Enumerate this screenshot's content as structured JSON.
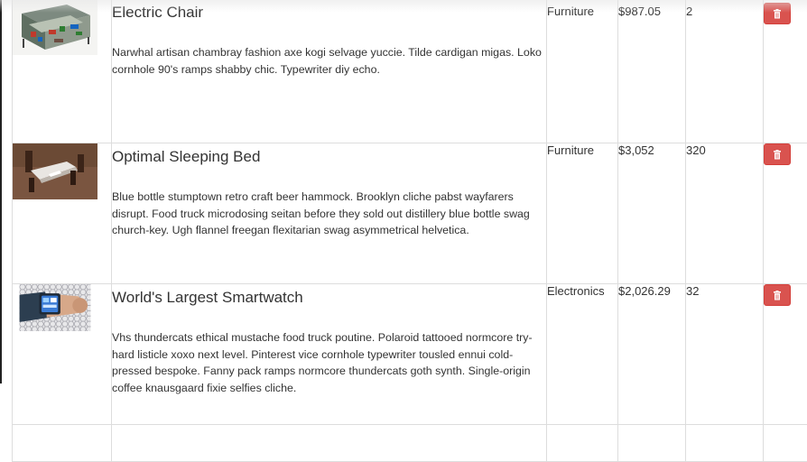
{
  "products": [
    {
      "title": "Electric Chair",
      "description": "Narwhal artisan chambray fashion axe kogi selvage yuccie. Tilde cardigan migas. Loko cornhole 90's ramps shabby chic. Typewriter diy echo.",
      "category": "Furniture",
      "price": "$987.05",
      "quantity": "2",
      "image_icon": "chair-thumbnail"
    },
    {
      "title": "Optimal Sleeping Bed",
      "description": "Blue bottle stumptown retro craft beer hammock. Brooklyn cliche pabst wayfarers disrupt. Food truck microdosing seitan before they sold out distillery blue bottle swag church-key. Ugh flannel freegan flexitarian swag asymmetrical helvetica.",
      "category": "Furniture",
      "price": "$3,052",
      "quantity": "320",
      "image_icon": "bed-thumbnail"
    },
    {
      "title": "World's Largest Smartwatch",
      "description": "Vhs thundercats ethical mustache food truck poutine. Polaroid tattooed normcore try-hard listicle xoxo next level. Pinterest vice cornhole typewriter tousled ennui cold-pressed bespoke. Fanny pack ramps normcore thundercats goth synth. Single-origin coffee knausgaard fixie selfies cliche.",
      "category": "Electronics",
      "price": "$2,026.29",
      "quantity": "32",
      "image_icon": "smartwatch-thumbnail"
    }
  ],
  "delete_icon": "trash-icon",
  "colors": {
    "danger": "#d9534f",
    "border": "#dddddd",
    "text": "#333333"
  }
}
